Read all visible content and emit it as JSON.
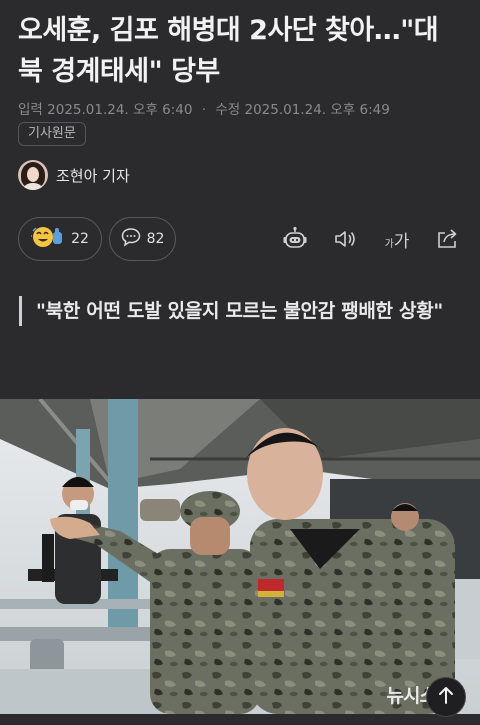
{
  "article": {
    "headline": "오세훈, 김포 해병대 2사단 찾아…\"대북 경계태세\" 당부",
    "published_label": "입력",
    "published": "2025.01.24. 오후 6:40",
    "modified_label": "수정",
    "modified": "2025.01.24. 오후 6:49",
    "original_link_label": "기사원문",
    "author": "조현아 기자",
    "reaction_count": "22",
    "comment_count": "82",
    "font_size_glyph_small": "가",
    "font_size_glyph_large": "가",
    "subheading": "\"북한 어떤 도발 있을지 모르는 불안감 팽배한 상황\"",
    "photo_watermark": "뉴시스"
  },
  "icons": {
    "reaction": "emoji-reaction-icon",
    "comment": "speech-bubble-icon",
    "tts": "robot-tts-icon",
    "audio": "speaker-icon",
    "font_size": "font-size-icon",
    "share": "share-icon",
    "scroll_top": "arrow-up-icon"
  },
  "colors": {
    "background": "#2b2b2e",
    "text_primary": "#f2f2f2",
    "text_secondary": "#8a8a8e"
  }
}
